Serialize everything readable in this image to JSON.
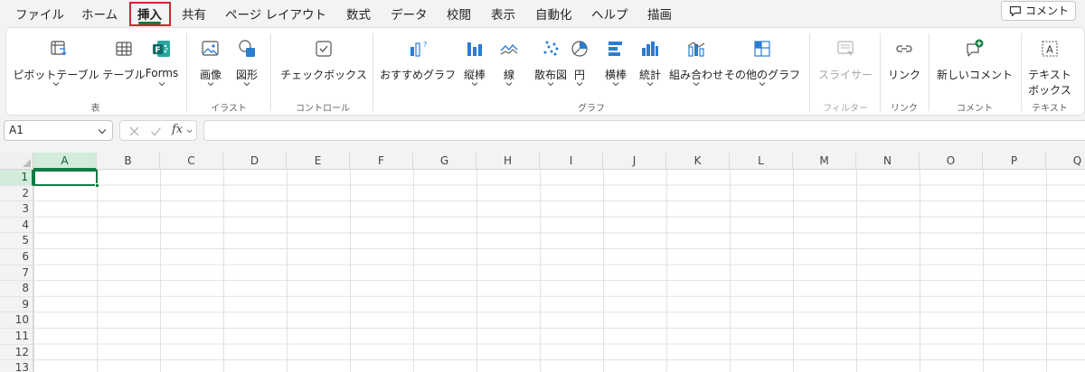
{
  "tabs": [
    "ファイル",
    "ホーム",
    "挿入",
    "共有",
    "ページ レイアウト",
    "数式",
    "データ",
    "校閲",
    "表示",
    "自動化",
    "ヘルプ",
    "描画"
  ],
  "active_tab": "挿入",
  "comment_button": "コメント",
  "ribbon": {
    "pivot_table": "ピボットテーブル",
    "table": "テーブル",
    "forms": "Forms",
    "image": "画像",
    "shapes": "図形",
    "checkbox": "チェックボックス",
    "recommended_charts": "おすすめグラフ",
    "column_chart": "縦棒",
    "line_chart": "線",
    "scatter_chart": "散布図",
    "pie_chart": "円",
    "bar_chart": "横棒",
    "statistic_chart": "統計",
    "combo_chart": "組み合わせ",
    "other_charts": "その他のグラフ",
    "slicer": "スライサー",
    "link": "リンク",
    "new_comment": "新しいコメント",
    "textbox_line1": "テキスト",
    "textbox_line2": "ボックス"
  },
  "groups": {
    "tables": "表",
    "illustrations": "イラスト",
    "controls": "コントロール",
    "charts": "グラフ",
    "filters": "フィルター",
    "links": "リンク",
    "comments": "コメント",
    "text": "テキスト"
  },
  "formula_bar": {
    "name_box": "A1",
    "fx": "fx",
    "formula": ""
  },
  "columns": [
    "A",
    "B",
    "C",
    "D",
    "E",
    "F",
    "G",
    "H",
    "I",
    "J",
    "K",
    "L",
    "M",
    "N",
    "O",
    "P",
    "Q"
  ],
  "rows": [
    "1",
    "2",
    "3",
    "4",
    "5",
    "6",
    "7",
    "8",
    "9",
    "10",
    "11",
    "12",
    "13"
  ],
  "active_cell": "A1",
  "colors": {
    "accent": "#107c41",
    "highlight": "#d1242f",
    "chart_icon": "#2b7cd3"
  }
}
